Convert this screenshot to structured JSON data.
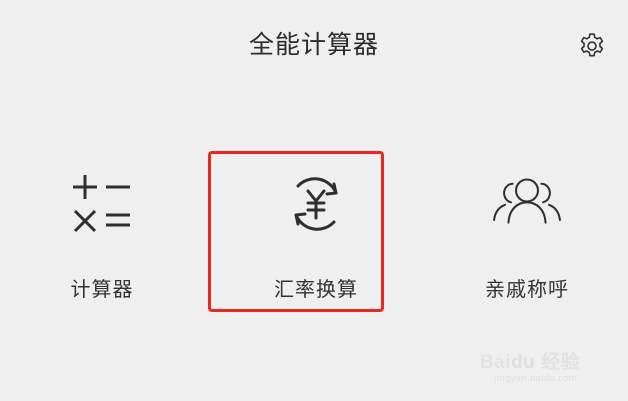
{
  "header": {
    "title": "全能计算器",
    "settings_icon": "gear-icon"
  },
  "tiles": [
    {
      "label": "计算器",
      "icon": "arithmetic-operators-icon"
    },
    {
      "label": "汇率换算",
      "icon": "currency-exchange-icon",
      "highlighted": true
    },
    {
      "label": "亲戚称呼",
      "icon": "relatives-group-icon"
    }
  ],
  "highlight_color": "#e8281f",
  "watermark": {
    "brand": "Bai",
    "paw": "du",
    "suffix": "经验",
    "url": "jingyan.baidu.com"
  }
}
